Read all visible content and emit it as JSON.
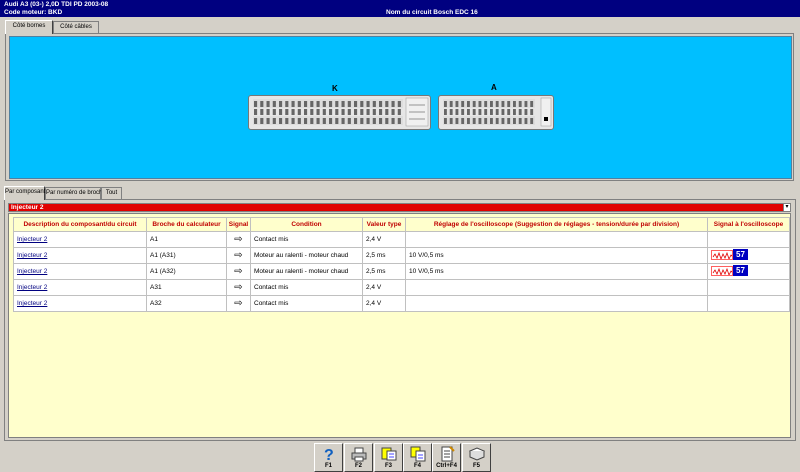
{
  "title": {
    "line1": "Audi   A3 (03-) 2,0D TDI PD 2003-08",
    "line2": "Code moteur: BKD",
    "center": "Nom du circuit Bosch EDC 16"
  },
  "top_tabs": [
    "Côté bornes",
    "Côté câbles"
  ],
  "connectors": {
    "left_label": "K",
    "right_label": "A"
  },
  "lower_tabs": [
    "Par composant",
    "Par numéro de broche",
    "Tout"
  ],
  "selector": {
    "value": "Injecteur 2"
  },
  "table": {
    "headers": [
      "Description du composant/du circuit",
      "Broche du calculateur",
      "Signal",
      "Condition",
      "Valeur type",
      "Réglage de l'oscilloscope (Suggestion de réglages - tension/durée par division)",
      "Signal à l'oscilloscope"
    ],
    "rows": [
      {
        "component": "Injecteur 2",
        "pin": "A1",
        "signal": "⇨",
        "condition": "Contact mis",
        "value": "2,4 V",
        "scope_setting": "",
        "scope_signal": ""
      },
      {
        "component": "Injecteur 2",
        "pin": "A1 (A31)",
        "signal": "⇨",
        "condition": "Moteur au ralenti - moteur chaud",
        "value": "2,5 ms",
        "scope_setting": "10 V/0,5 ms",
        "scope_signal": "57"
      },
      {
        "component": "Injecteur 2",
        "pin": "A1 (A32)",
        "signal": "⇨",
        "condition": "Moteur au ralenti - moteur chaud",
        "value": "2,5 ms",
        "scope_setting": "10 V/0,5 ms",
        "scope_signal": "57"
      },
      {
        "component": "Injecteur 2",
        "pin": "A31",
        "signal": "⇨",
        "condition": "Contact mis",
        "value": "2,4 V",
        "scope_setting": "",
        "scope_signal": ""
      },
      {
        "component": "Injecteur 2",
        "pin": "A32",
        "signal": "⇨",
        "condition": "Contact mis",
        "value": "2,4 V",
        "scope_setting": "",
        "scope_signal": ""
      }
    ]
  },
  "toolbar": [
    {
      "key": "F1",
      "icon": "help-icon"
    },
    {
      "key": "F2",
      "icon": "print-icon"
    },
    {
      "key": "F3",
      "icon": "print-preview-icon"
    },
    {
      "key": "F4",
      "icon": "copy-icon"
    },
    {
      "key": "Ctrl+F4",
      "icon": "notes-icon"
    },
    {
      "key": "F5",
      "icon": "manual-icon"
    }
  ],
  "colors": {
    "titlebar": "#000080",
    "connector_background": "#00bfff",
    "selector": "#e00000",
    "table_background": "#ffffcc",
    "header_text": "#c00000"
  }
}
